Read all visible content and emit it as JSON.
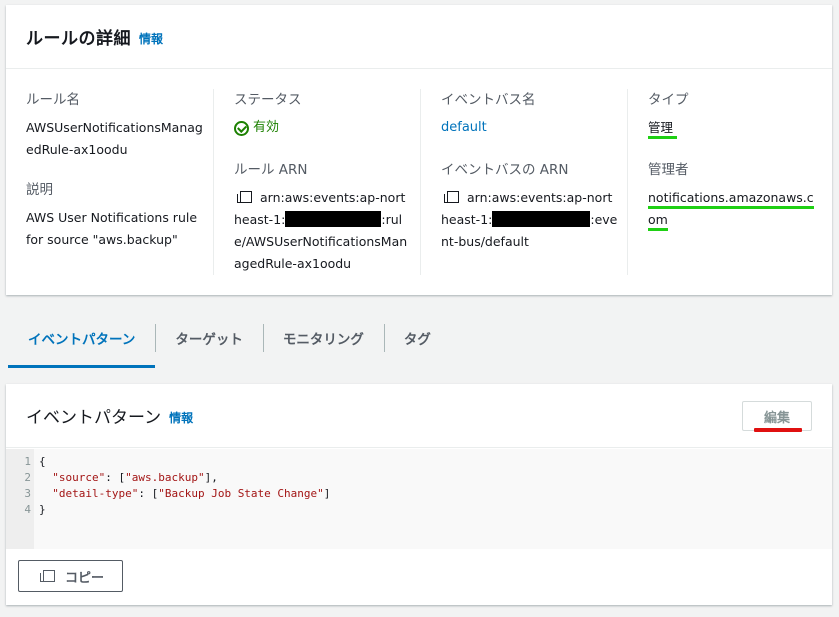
{
  "details": {
    "title": "ルールの詳細",
    "info": "情報",
    "rule_name_label": "ルール名",
    "rule_name_value": "AWSUserNotificationsManagedRule-ax1oodu",
    "description_label": "説明",
    "description_value": "AWS User Notifications rule for source \"aws.backup\"",
    "status_label": "ステータス",
    "status_value": "有効",
    "rule_arn_label": "ルール ARN",
    "rule_arn_prefix": "arn:aws:events:ap-northeast-1:",
    "rule_arn_suffix": ":rule/AWSUserNotificationsManagedRule-ax1oodu",
    "event_bus_label": "イベントバス名",
    "event_bus_value": "default",
    "event_bus_arn_label": "イベントバスの ARN",
    "event_bus_arn_prefix": "arn:aws:events:ap-northeast-1:",
    "event_bus_arn_suffix": ":event-bus/default",
    "type_label": "タイプ",
    "type_value": "管理",
    "manager_label": "管理者",
    "manager_value": "notifications.amazonaws.com"
  },
  "tabs": [
    {
      "label": "イベントパターン",
      "active": true
    },
    {
      "label": "ターゲット",
      "active": false
    },
    {
      "label": "モニタリング",
      "active": false
    },
    {
      "label": "タグ",
      "active": false
    }
  ],
  "pattern": {
    "title": "イベントパターン",
    "info": "情報",
    "edit_label": "編集",
    "copy_label": "コピー",
    "lines": [
      {
        "num": "1",
        "text": "{"
      },
      {
        "num": "2",
        "key": "\"source\"",
        "sep": ": [",
        "val": "\"aws.backup\"",
        "end": "],"
      },
      {
        "num": "3",
        "key": "\"detail-type\"",
        "sep": ": [",
        "val": "\"Backup Job State Change\"",
        "end": "]"
      },
      {
        "num": "4",
        "text": "}"
      }
    ]
  },
  "colors": {
    "link": "#0073bb",
    "status_green": "#1d8102",
    "highlight_green": "#1fd014",
    "highlight_red": "#e01010"
  }
}
